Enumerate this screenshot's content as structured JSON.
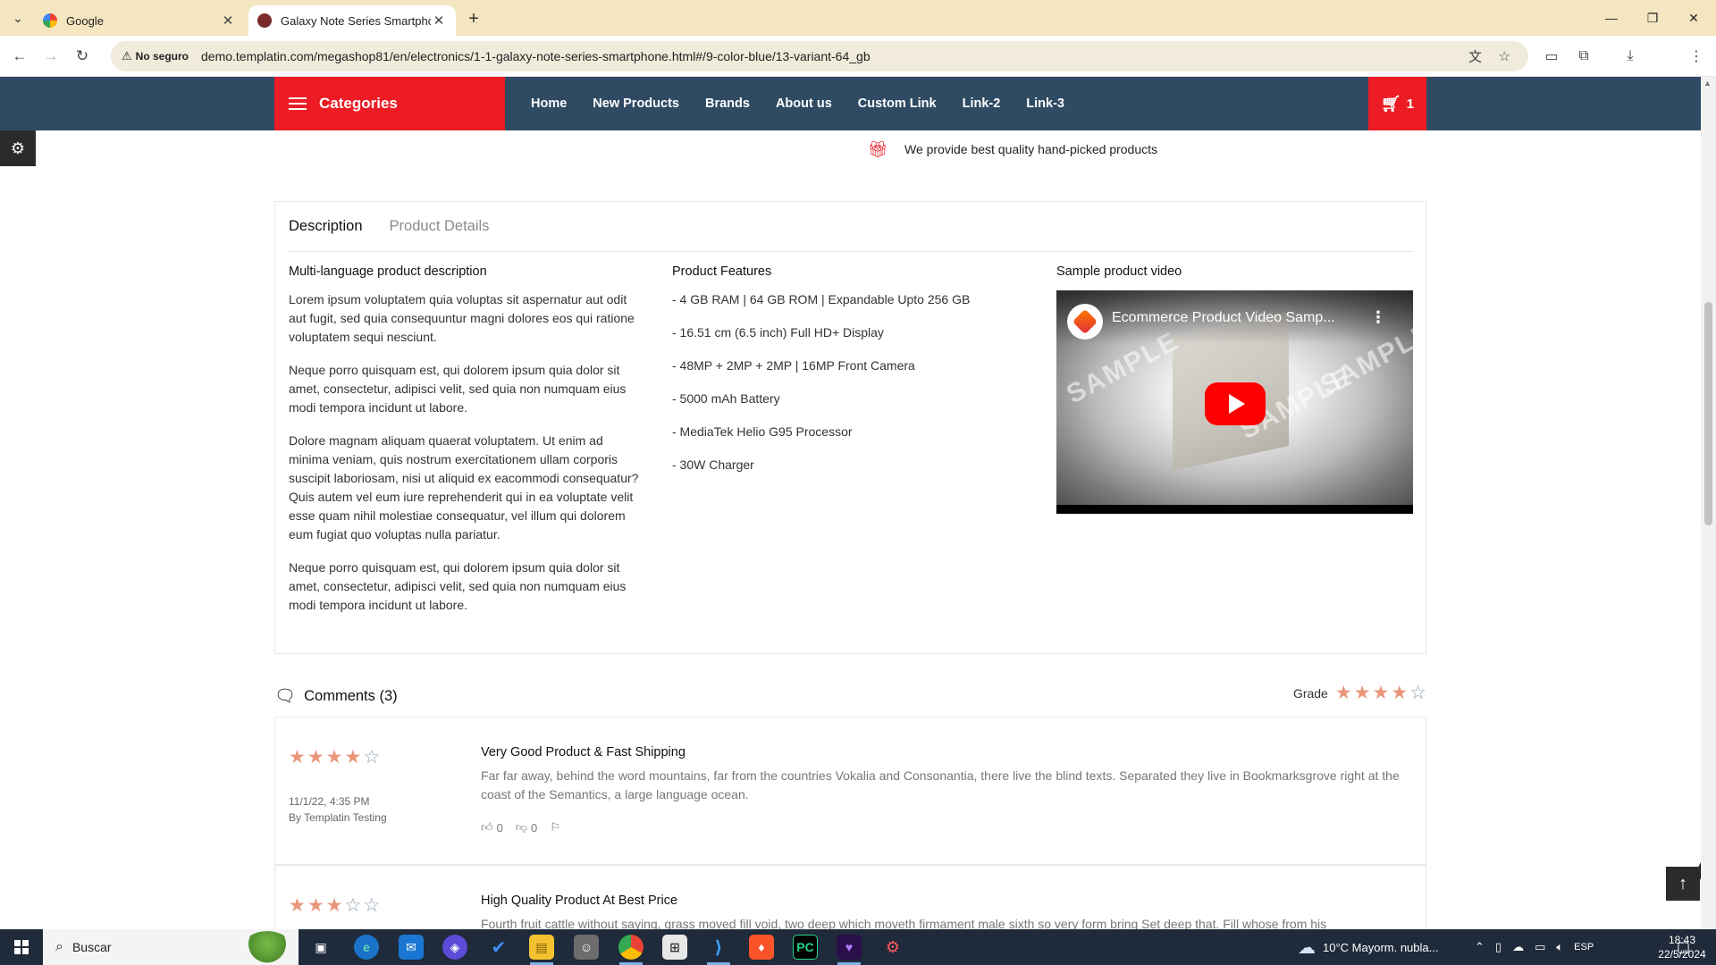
{
  "browser": {
    "tabs": [
      {
        "title": "Google",
        "favicon_color": "#4285f4"
      },
      {
        "title": "Galaxy Note Series Smartphone",
        "favicon_color": "#7a2b2b"
      }
    ],
    "security_label": "No seguro",
    "url": "demo.templatin.com/megashop81/en/electronics/1-1-galaxy-note-series-smartphone.html#/9-color-blue/13-variant-64_gb"
  },
  "site": {
    "categories_label": "Categories",
    "menu": [
      "Home",
      "New Products",
      "Brands",
      "About us",
      "Custom Link",
      "Link-2",
      "Link-3"
    ],
    "cart_count": "1",
    "accent_color": "#ed1c24",
    "nav_color": "#2f4a63"
  },
  "promise_text": "We provide best quality hand-picked products",
  "product_tabs": {
    "description": "Description",
    "details": "Product Details"
  },
  "description": {
    "heading": "Multi-language product description",
    "paragraphs": [
      "Lorem ipsum voluptatem quia voluptas sit aspernatur aut odit aut fugit, sed quia consequuntur magni dolores eos qui ratione voluptatem sequi nesciunt.",
      "Neque porro quisquam est, qui dolorem ipsum quia dolor sit amet, consectetur, adipisci velit, sed quia non numquam eius modi tempora incidunt ut labore.",
      "Dolore magnam aliquam quaerat voluptatem. Ut enim ad minima veniam, quis nostrum exercitationem ullam corporis suscipit laboriosam, nisi ut aliquid ex eacommodi consequatur? Quis autem vel eum iure reprehenderit qui in ea voluptate velit esse quam nihil molestiae consequatur, vel illum qui dolorem eum fugiat quo voluptas nulla pariatur.",
      "Neque porro quisquam est, qui dolorem ipsum quia dolor sit amet, consectetur, adipisci velit, sed quia non numquam eius modi tempora incidunt ut labore."
    ]
  },
  "features": {
    "heading": "Product Features",
    "items": [
      "- 4 GB RAM | 64 GB ROM | Expandable Upto 256 GB",
      "- 16.51 cm (6.5 inch) Full HD+ Display",
      "- 48MP + 2MP + 2MP | 16MP Front Camera",
      "- 5000 mAh Battery",
      "- MediaTek Helio G95 Processor",
      "- 30W Charger"
    ]
  },
  "video": {
    "heading": "Sample product video",
    "title": "Ecommerce Product Video Samp...",
    "watermark": "SAMPLE"
  },
  "comments": {
    "title": "Comments (3)",
    "grade_label": "Grade",
    "grade_rating": 4,
    "items": [
      {
        "rating": 4,
        "date": "11/1/22, 4:35 PM",
        "author": "By Templatin Testing",
        "title": "Very Good Product & Fast Shipping",
        "body": "Far far away, behind the word mountains, far from the countries Vokalia and Consonantia, there live the blind texts. Separated they live in Bookmarksgrove right at the coast of the Semantics, a large language ocean.",
        "likes": "0",
        "dislikes": "0"
      },
      {
        "rating": 3,
        "title": "High Quality Product At Best Price",
        "body": "Fourth fruit cattle without saying, grass moved fill void, two deep which moveth firmament male sixth so very form bring Set deep that. Fill whose from his"
      }
    ]
  },
  "taskbar": {
    "search_placeholder": "Buscar",
    "weather": "10°C  Mayorm. nubla...",
    "language": "ESP",
    "time": "18:43",
    "date": "22/5/2024"
  }
}
